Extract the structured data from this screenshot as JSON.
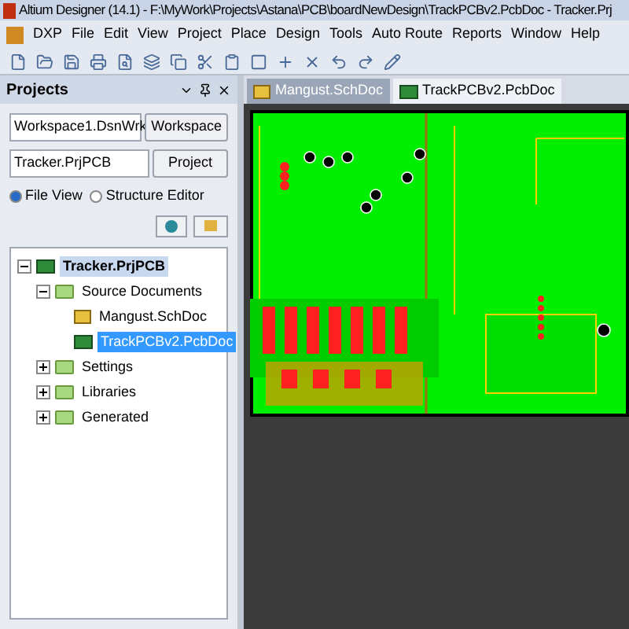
{
  "window": {
    "title": "Altium Designer (14.1) - F:\\MyWork\\Projects\\Astana\\PCB\\boardNewDesign\\TrackPCBv2.PcbDoc - Tracker.Prj"
  },
  "menu": [
    "DXP",
    "File",
    "Edit",
    "View",
    "Project",
    "Place",
    "Design",
    "Tools",
    "Auto Route",
    "Reports",
    "Window",
    "Help"
  ],
  "tabs": [
    {
      "label": "Mangust.SchDoc",
      "kind": "sch",
      "selected": false
    },
    {
      "label": "TrackPCBv2.PcbDoc",
      "kind": "pcb",
      "selected": true
    }
  ],
  "projects_panel": {
    "title": "Projects",
    "workspace": "Workspace1.DsnWrk",
    "workspace_button": "Workspace",
    "project": "Tracker.PrjPCB",
    "project_button": "Project",
    "views": [
      {
        "label": "File View",
        "selected": true
      },
      {
        "label": "Structure Editor",
        "selected": false
      }
    ],
    "tree": [
      {
        "label": "Tracker.PrjPCB",
        "kind": "project",
        "expanded": true,
        "selected": false,
        "children": [
          {
            "label": "Source Documents",
            "kind": "folder",
            "expanded": true,
            "selected": false,
            "children": [
              {
                "label": "Mangust.SchDoc",
                "kind": "sch",
                "selected": false
              },
              {
                "label": "TrackPCBv2.PcbDoc",
                "kind": "pcb",
                "selected": true
              }
            ]
          },
          {
            "label": "Settings",
            "kind": "folder",
            "expanded": false,
            "selected": false
          },
          {
            "label": "Libraries",
            "kind": "folder",
            "expanded": false,
            "selected": false
          },
          {
            "label": "Generated",
            "kind": "folder",
            "expanded": false,
            "selected": false
          }
        ]
      }
    ]
  }
}
